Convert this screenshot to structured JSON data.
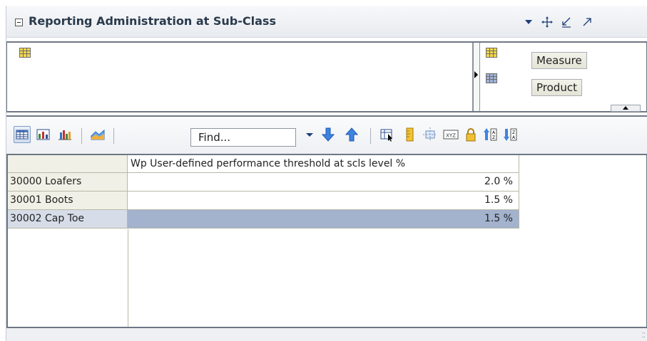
{
  "header": {
    "title": "Reporting Administration at Sub-Class",
    "icons": [
      "collapse-icon",
      "dropdown-icon",
      "move-icon",
      "restore-icon",
      "maximize-icon"
    ]
  },
  "layout": {
    "dimensions": [
      {
        "label": "Measure",
        "icon": "tile-icon"
      },
      {
        "label": "Product",
        "icon": "tile-icon"
      }
    ]
  },
  "toolbar": {
    "find_placeholder": "Find...",
    "find_value": "Find..."
  },
  "grid": {
    "column_header": "Wp User-defined performance threshold at scls level %",
    "rows": [
      {
        "label": "30000 Loafers",
        "value": "2.0 %",
        "selected": false
      },
      {
        "label": "30001 Boots",
        "value": "1.5 %",
        "selected": false
      },
      {
        "label": "30002 Cap Toe",
        "value": "1.5 %",
        "selected": true
      }
    ]
  },
  "colors": {
    "selected_cell": "#a3b2cd",
    "row_header_bg": "#f1f0e6",
    "title_text": "#2a3a4c",
    "icon_blue": "#2f6fd0"
  }
}
